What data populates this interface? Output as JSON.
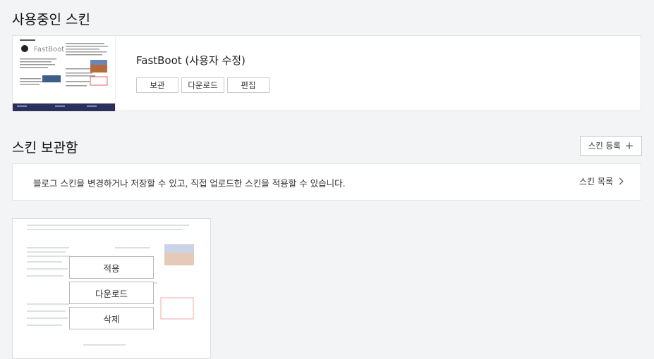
{
  "active_section": {
    "title": "사용중인 스킨",
    "skin_name": "FastBoot (사용자 수정)",
    "buttons": {
      "archive": "보관",
      "download": "다운로드",
      "edit": "편집"
    }
  },
  "storage_section": {
    "title": "스킨 보관함",
    "register_label": "스킨 등록",
    "info_text": "블로그 스킨을 변경하거나 저장할 수 있고, 직접 업로드한 스킨을 적용할 수 있습니다.",
    "list_link": "스킨 목록",
    "stored_card": {
      "apply": "적용",
      "download": "다운로드",
      "delete": "삭제"
    }
  },
  "colors": {
    "background": "#f3f4f6",
    "thumb_footer": "#2b2f5c",
    "card_border": "#e3e4e6"
  }
}
